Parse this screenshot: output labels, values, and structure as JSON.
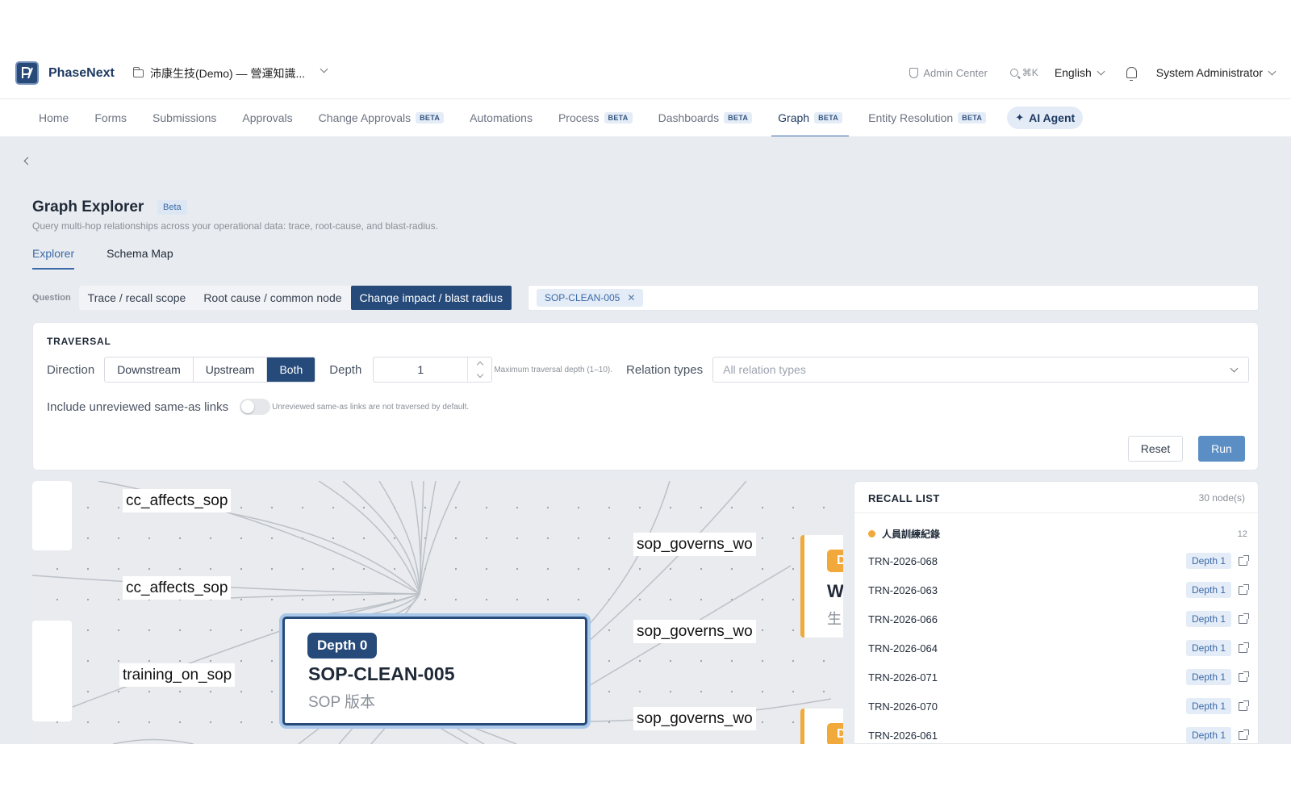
{
  "header": {
    "brand": "PhaseNext",
    "workspace": "沛康生技(Demo) — 營運知識...",
    "admin_center": "Admin Center",
    "search_shortcut": "⌘K",
    "language": "English",
    "user": "System Administrator"
  },
  "nav": {
    "items": [
      {
        "label": "Home",
        "badge": ""
      },
      {
        "label": "Forms",
        "badge": ""
      },
      {
        "label": "Submissions",
        "badge": ""
      },
      {
        "label": "Approvals",
        "badge": ""
      },
      {
        "label": "Change Approvals",
        "badge": "BETA"
      },
      {
        "label": "Automations",
        "badge": ""
      },
      {
        "label": "Process",
        "badge": "BETA"
      },
      {
        "label": "Dashboards",
        "badge": "BETA"
      },
      {
        "label": "Graph",
        "badge": "BETA"
      },
      {
        "label": "Entity Resolution",
        "badge": "BETA"
      }
    ],
    "active": "Graph",
    "ai_agent": "AI Agent"
  },
  "page": {
    "title": "Graph Explorer",
    "beta": "Beta",
    "subtitle": "Query multi-hop relationships across your operational data: trace, root-cause, and blast-radius.",
    "tabs": [
      "Explorer",
      "Schema Map"
    ]
  },
  "question": {
    "label": "Question",
    "options": [
      "Trace / recall scope",
      "Root cause / common node",
      "Change impact / blast radius"
    ],
    "selected": "Change impact / blast radius",
    "chip": "SOP-CLEAN-005"
  },
  "traversal": {
    "title": "TRAVERSAL",
    "direction_label": "Direction",
    "directions": [
      "Downstream",
      "Upstream",
      "Both"
    ],
    "direction_selected": "Both",
    "depth_label": "Depth",
    "depth_value": "1",
    "depth_hint": "Maximum traversal depth (1–10).",
    "relation_label": "Relation types",
    "relation_placeholder": "All relation types",
    "unreviewed_label": "Include unreviewed same-as links",
    "unreviewed_hint": "Unreviewed same-as links are not traversed by default.",
    "unreviewed_on": false,
    "reset": "Reset",
    "run": "Run"
  },
  "graph": {
    "center": {
      "depth": "Depth 0",
      "title": "SOP-CLEAN-005",
      "subtitle": "SOP 版本"
    },
    "edge_labels": [
      "cc_affects_sop",
      "cc_affects_sop",
      "training_on_sop",
      "sop_governs_wo",
      "sop_governs_wo",
      "sop_governs_wo"
    ],
    "right_card": {
      "badge": "D",
      "letter": "W",
      "sub": "生"
    },
    "right_card2": {
      "badge": "D"
    }
  },
  "recall": {
    "title": "RECALL LIST",
    "count": "30 node(s)",
    "group": {
      "name": "人員訓練紀錄",
      "count": "12",
      "color": "#f0a93a"
    },
    "items": [
      {
        "id": "TRN-2026-068",
        "depth": "Depth 1"
      },
      {
        "id": "TRN-2026-063",
        "depth": "Depth 1"
      },
      {
        "id": "TRN-2026-066",
        "depth": "Depth 1"
      },
      {
        "id": "TRN-2026-064",
        "depth": "Depth 1"
      },
      {
        "id": "TRN-2026-071",
        "depth": "Depth 1"
      },
      {
        "id": "TRN-2026-070",
        "depth": "Depth 1"
      },
      {
        "id": "TRN-2026-061",
        "depth": "Depth 1"
      }
    ]
  },
  "colors": {
    "primary": "#264a7a",
    "accent": "#3b6aa8",
    "orange": "#f0a93a",
    "run": "#5b8ec4"
  }
}
